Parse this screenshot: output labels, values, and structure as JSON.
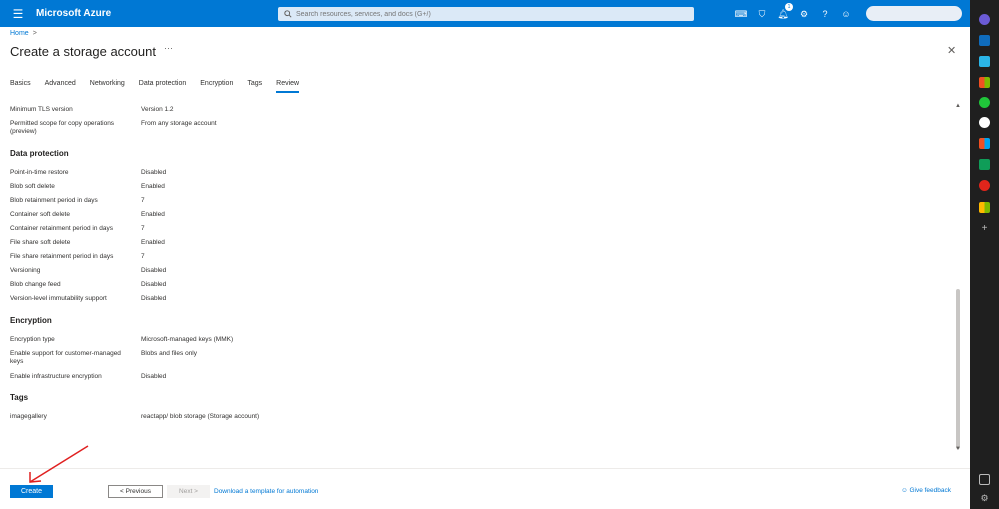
{
  "topbar": {
    "brand": "Microsoft Azure",
    "search_placeholder": "Search resources, services, and docs (G+/)",
    "notification_count": "1"
  },
  "breadcrumb": {
    "home": "Home",
    "separator": ">"
  },
  "page": {
    "title": "Create a storage account",
    "more": "···",
    "close": "✕"
  },
  "tabs": [
    {
      "label": "Basics"
    },
    {
      "label": "Advanced"
    },
    {
      "label": "Networking"
    },
    {
      "label": "Data protection"
    },
    {
      "label": "Encryption"
    },
    {
      "label": "Tags"
    },
    {
      "label": "Review",
      "active": true
    }
  ],
  "review": {
    "top_rows": [
      {
        "label": "Minimum TLS version",
        "value": "Version 1.2"
      },
      {
        "label": "Permitted scope for copy operations (preview)",
        "value": "From any storage account"
      }
    ],
    "data_protection": {
      "heading": "Data protection",
      "rows": [
        {
          "label": "Point-in-time restore",
          "value": "Disabled"
        },
        {
          "label": "Blob soft delete",
          "value": "Enabled"
        },
        {
          "label": "Blob retainment period in days",
          "value": "7"
        },
        {
          "label": "Container soft delete",
          "value": "Enabled"
        },
        {
          "label": "Container retainment period in days",
          "value": "7"
        },
        {
          "label": "File share soft delete",
          "value": "Enabled"
        },
        {
          "label": "File share retainment period in days",
          "value": "7"
        },
        {
          "label": "Versioning",
          "value": "Disabled"
        },
        {
          "label": "Blob change feed",
          "value": "Disabled"
        },
        {
          "label": "Version-level immutability support",
          "value": "Disabled"
        }
      ]
    },
    "encryption": {
      "heading": "Encryption",
      "rows": [
        {
          "label": "Encryption type",
          "value": "Microsoft-managed keys (MMK)"
        },
        {
          "label": "Enable support for customer-managed keys",
          "value": "Blobs and files only"
        },
        {
          "label": "Enable infrastructure encryption",
          "value": "Disabled"
        }
      ]
    },
    "tags": {
      "heading": "Tags",
      "rows": [
        {
          "label": "imagegallery",
          "value": "reactapp/ blob storage (Storage account)"
        }
      ]
    }
  },
  "footer": {
    "create": "Create",
    "previous": "< Previous",
    "next": "Next >",
    "template_link": "Download a template for automation",
    "feedback": "Give feedback"
  },
  "colors": {
    "accent": "#0078d4",
    "annotation_arrow": "#e02020"
  }
}
